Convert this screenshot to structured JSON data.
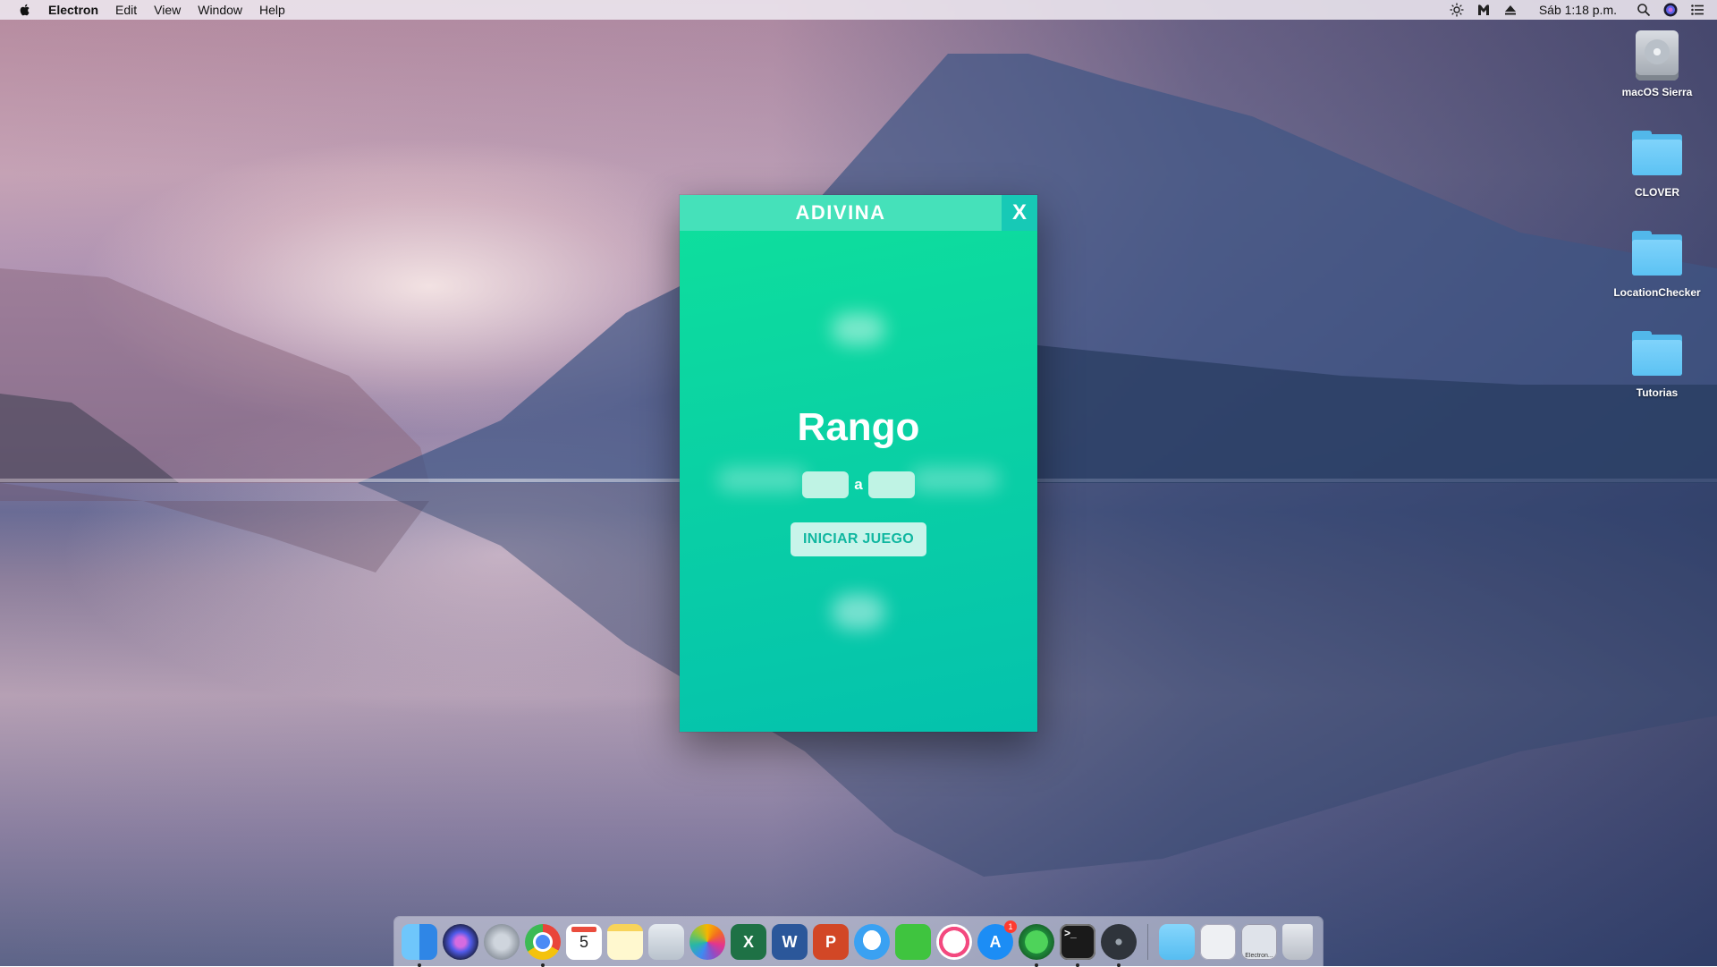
{
  "menubar": {
    "app_name": "Electron",
    "items": [
      "Edit",
      "View",
      "Window",
      "Help"
    ],
    "clock": "Sáb 1:18 p.m."
  },
  "desktop_icons": [
    {
      "label": "macOS Sierra",
      "type": "drive"
    },
    {
      "label": "CLOVER",
      "type": "folder"
    },
    {
      "label": "LocationChecker",
      "type": "folder"
    },
    {
      "label": "Tutorias",
      "type": "folder"
    }
  ],
  "app": {
    "title": "ADIVINA",
    "close_label": "X",
    "range_title": "Rango",
    "range_from": "",
    "range_to": "",
    "range_separator": "a",
    "start_button": "INICIAR JUEGO"
  },
  "dock": {
    "items": [
      {
        "name": "finder-icon",
        "color": "#3a8ee6"
      },
      {
        "name": "siri-icon",
        "color": "#3b2f7a"
      },
      {
        "name": "launchpad-icon",
        "color": "#8a929e"
      },
      {
        "name": "chrome-icon",
        "color": "#e9453a"
      },
      {
        "name": "calendar-icon",
        "color": "#ffffff",
        "text": "5"
      },
      {
        "name": "notes-icon",
        "color": "#fbe67d"
      },
      {
        "name": "preview-icon",
        "color": "#cfd6de"
      },
      {
        "name": "photos-icon",
        "color": "#f4f4f4"
      },
      {
        "name": "excel-icon",
        "color": "#1e7145",
        "text": "X"
      },
      {
        "name": "word-icon",
        "color": "#2b579a",
        "text": "W"
      },
      {
        "name": "powerpoint-icon",
        "color": "#d24726",
        "text": "P"
      },
      {
        "name": "messages-icon",
        "color": "#3aa1f2"
      },
      {
        "name": "facetime-icon",
        "color": "#3fc43f"
      },
      {
        "name": "itunes-icon",
        "color": "#f0f0f6"
      },
      {
        "name": "appstore-icon",
        "color": "#1c8df5",
        "badge": "1"
      },
      {
        "name": "vibrant-icon",
        "color": "#1e8a3a"
      },
      {
        "name": "terminal-icon",
        "color": "#1a1a1a"
      },
      {
        "name": "atom-icon",
        "color": "#444b55"
      }
    ],
    "right_items": [
      {
        "name": "downloads-folder-icon",
        "color": "#5cc2f3"
      },
      {
        "name": "document-stack-icon",
        "color": "#e6e8ec"
      },
      {
        "name": "electron-window-icon",
        "color": "#d9dde4",
        "label": "Electron..."
      },
      {
        "name": "trash-icon",
        "color": "#c6cad1"
      }
    ]
  }
}
